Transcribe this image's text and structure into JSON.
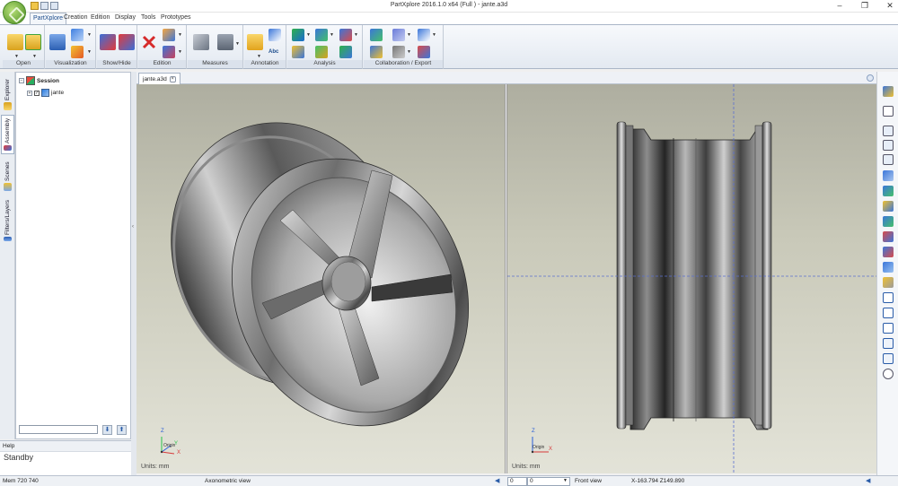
{
  "window": {
    "title": "PartXplore 2016.1.0 x64 (Full ) - jante.a3d",
    "minimize_glyph": "–",
    "maximize_glyph": "❐",
    "close_glyph": "✕"
  },
  "ribbon": {
    "tabs": [
      {
        "label": "PartXplore",
        "active": true
      },
      {
        "label": "Creation"
      },
      {
        "label": "Edition"
      },
      {
        "label": "Display"
      },
      {
        "label": "Tools"
      },
      {
        "label": "Prototypes"
      }
    ],
    "groups": [
      {
        "label": "Open",
        "icons": [
          "open-folder-icon",
          "recent-folder-icon"
        ]
      },
      {
        "label": "Visualization",
        "icons": [
          "display-mode-icon",
          "view-cube-icon",
          "color-brush-icon"
        ]
      },
      {
        "label": "Show/Hide",
        "icons": [
          "show-icon",
          "hide-icon"
        ]
      },
      {
        "label": "Edition",
        "icons": [
          "delete-icon",
          "move-icon",
          "transform-icon"
        ]
      },
      {
        "label": "Measures",
        "icons": [
          "measure-icon",
          "gauge-icon"
        ]
      },
      {
        "label": "Annotation",
        "icons": [
          "annotation-icon",
          "label-icon",
          "text-icon"
        ]
      },
      {
        "label": "Analysis",
        "icons": [
          "thickness-icon",
          "draft-icon",
          "section-icon",
          "compare-icon"
        ]
      },
      {
        "label": "Collaboration / Export",
        "icons": [
          "export-icon",
          "share-icon",
          "print-icon",
          "publish-icon"
        ]
      }
    ],
    "annotation_text_badge": "Abc"
  },
  "sidebar": {
    "tabs": [
      {
        "label": "Explorer"
      },
      {
        "label": "Assembly",
        "active": true
      },
      {
        "label": "Scenes"
      },
      {
        "label": "Filters/Layers"
      }
    ]
  },
  "tree": {
    "items": [
      {
        "label": "Session",
        "expander": "−",
        "level": 0
      },
      {
        "label": "jante",
        "expander": "+",
        "checked": true,
        "level": 1
      }
    ],
    "check_glyph": "✓",
    "search_placeholder": "",
    "down_arrow": "⬇",
    "up_arrow": "⬆"
  },
  "help": {
    "header": "Help",
    "status": "Standby"
  },
  "document": {
    "tab_label": "jante.a3d",
    "close_glyph": "×"
  },
  "viewports": {
    "left": {
      "units": "Units: mm",
      "view_name": "Axonometric view"
    },
    "right": {
      "units": "Units: mm",
      "view_name": "Front view"
    }
  },
  "triad": {
    "z": "Z",
    "x": "X",
    "y": "Y",
    "origin": "Origin"
  },
  "statusbar": {
    "memory": "Mem 720 740",
    "field1": "0",
    "field2": "0",
    "coordinates": "X-163.794 Z149.890"
  },
  "colors": {
    "accent": "#1d4d8c",
    "viewport_top": "#aeaea0",
    "viewport_bottom": "#e3e3d8",
    "crosshair": "#5a6fd0"
  }
}
